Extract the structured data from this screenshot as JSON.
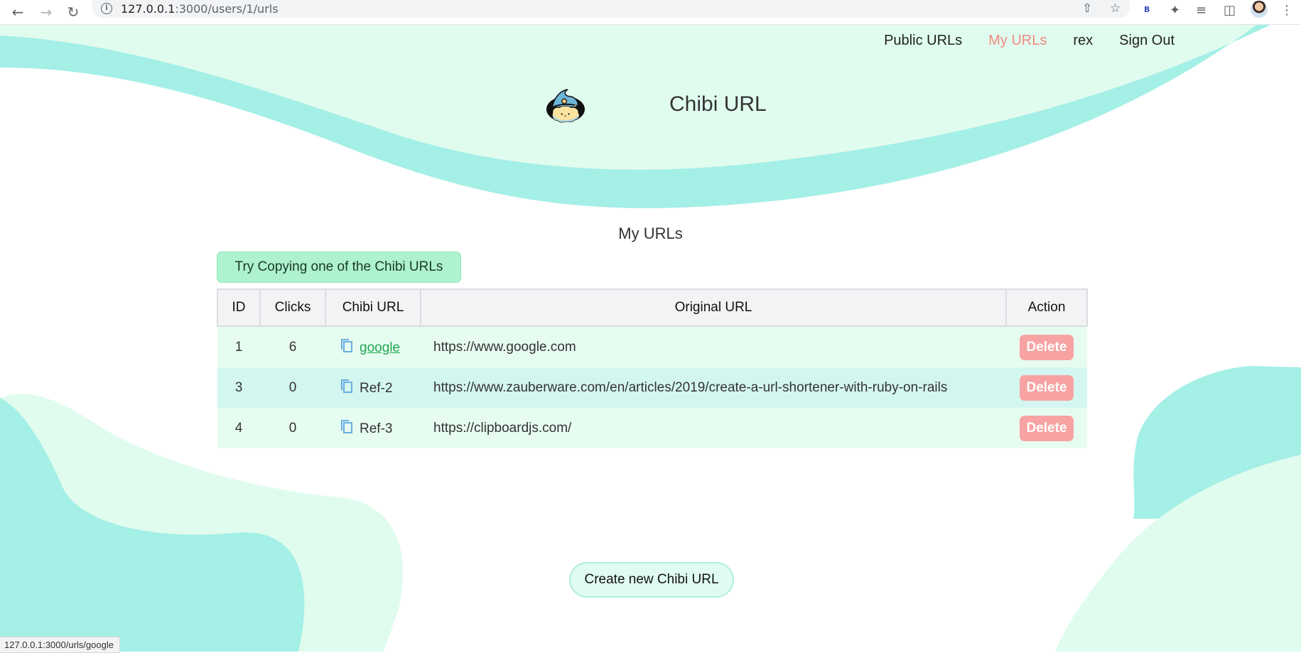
{
  "browser": {
    "url_host": "127.0.0.1",
    "url_rest": ":3000/users/1/urls",
    "status_text": "127.0.0.1:3000/urls/google",
    "extension_badge": "B"
  },
  "nav": {
    "public_urls": "Public URLs",
    "my_urls": "My URLs",
    "user": "rex",
    "sign_out": "Sign Out"
  },
  "brand": {
    "title": "Chibi URL"
  },
  "page": {
    "title": "My URLs",
    "notice": "Try Copying one of the Chibi URLs",
    "create_button": "Create new Chibi URL"
  },
  "table": {
    "headers": [
      "ID",
      "Clicks",
      "Chibi URL",
      "Original URL",
      "Action"
    ],
    "rows": [
      {
        "id": "1",
        "clicks": "6",
        "chibi": "google",
        "original": "https://www.google.com",
        "action": "Delete",
        "hovered": true
      },
      {
        "id": "3",
        "clicks": "0",
        "chibi": "Ref-2",
        "original": "https://www.zauberware.com/en/articles/2019/create-a-url-shortener-with-ruby-on-rails",
        "action": "Delete",
        "hovered": false
      },
      {
        "id": "4",
        "clicks": "0",
        "chibi": "Ref-3",
        "original": "https://clipboardjs.com/",
        "action": "Delete",
        "hovered": false
      }
    ]
  },
  "colors": {
    "active_nav": "#f08a80",
    "wave_light": "#e0fcef",
    "wave_teal": "#a4efe6",
    "delete_button": "#f7a3a3",
    "link": "#1fa74e"
  }
}
